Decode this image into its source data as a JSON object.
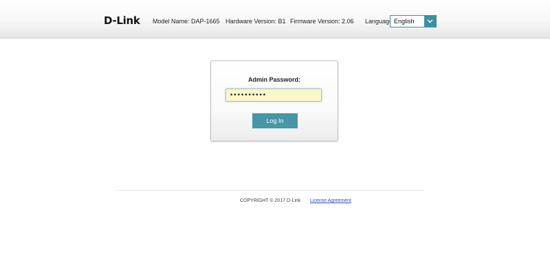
{
  "header": {
    "logo": "D-Link",
    "model": "Model Name: DAP-1665",
    "hardware": "Hardware Version: B1",
    "firmware": "Firmware Version: 2.06",
    "language_label": "Language:",
    "language_value": "English",
    "dropdown_icon": "chevron-down-icon"
  },
  "login": {
    "label": "Admin Password:",
    "password_value": "••••••••••",
    "button": "Log In"
  },
  "footer": {
    "copyright": "COPYRIGHT © 2017 D-Link",
    "license": "License Agreement"
  },
  "colors": {
    "accent": "#4796a6",
    "input_fill": "#fbf7c8",
    "link": "#2a4ad0"
  }
}
